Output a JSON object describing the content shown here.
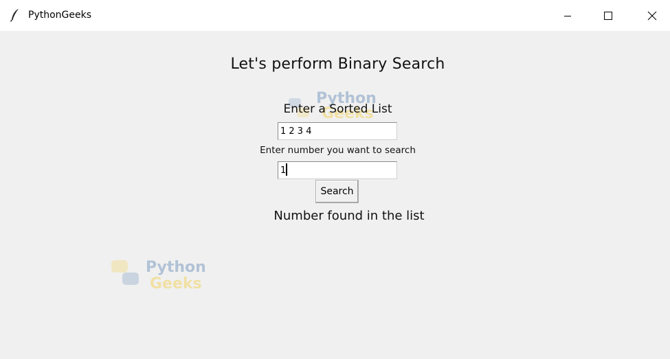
{
  "window": {
    "title": "PythonGeeks",
    "controls": {
      "minimize_icon": "minimize-icon",
      "maximize_icon": "maximize-icon",
      "close_icon": "close-icon"
    }
  },
  "main": {
    "heading": "Let's perform Binary Search",
    "list_label": "Enter a Sorted List",
    "list_value": "1 2 3 4",
    "search_label": "Enter number you want to search",
    "search_value": "1",
    "search_button": "Search",
    "result": "Number found in the list"
  },
  "watermark": {
    "line1": "Python",
    "line2": "Geeks",
    "color_blue": "#3d6fa8",
    "color_yellow": "#f5c518"
  },
  "colors": {
    "background": "#f0f0f0",
    "titlebar": "#ffffff"
  }
}
